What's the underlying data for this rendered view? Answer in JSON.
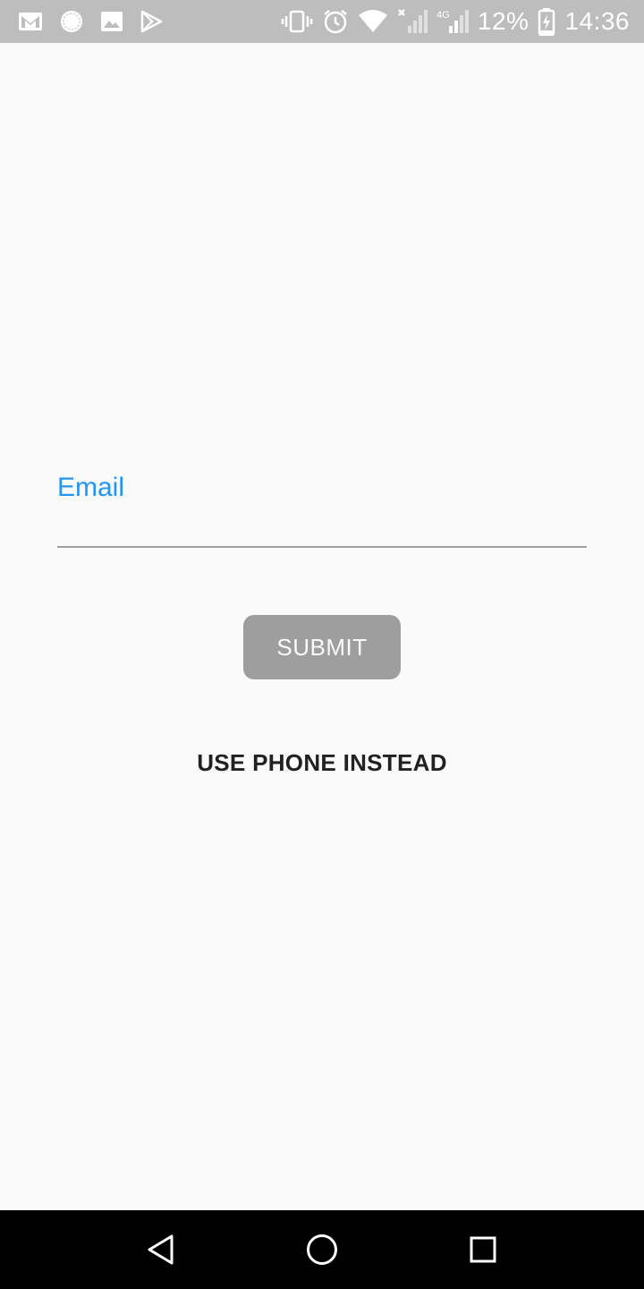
{
  "status_bar": {
    "battery": "12%",
    "time": "14:36",
    "network": "4G",
    "left_icons": [
      "gmail-icon",
      "sync-icon",
      "image-icon",
      "play-store-icon"
    ],
    "right_icons": [
      "vibrate-icon",
      "alarm-icon",
      "wifi-icon",
      "signal-icon",
      "signal-4g-icon",
      "battery-charging-icon"
    ]
  },
  "form": {
    "email_label": "Email",
    "email_value": "",
    "submit_label": "SUBMIT",
    "alt_link_label": "USE PHONE INSTEAD"
  },
  "nav": {
    "icons": [
      "back-icon",
      "home-icon",
      "recents-icon"
    ]
  },
  "colors": {
    "status_bar": "#bdbdbd",
    "background": "#fafafa",
    "accent": "#2196f3",
    "button_disabled": "#9e9e9e",
    "nav_bar": "#000000"
  }
}
